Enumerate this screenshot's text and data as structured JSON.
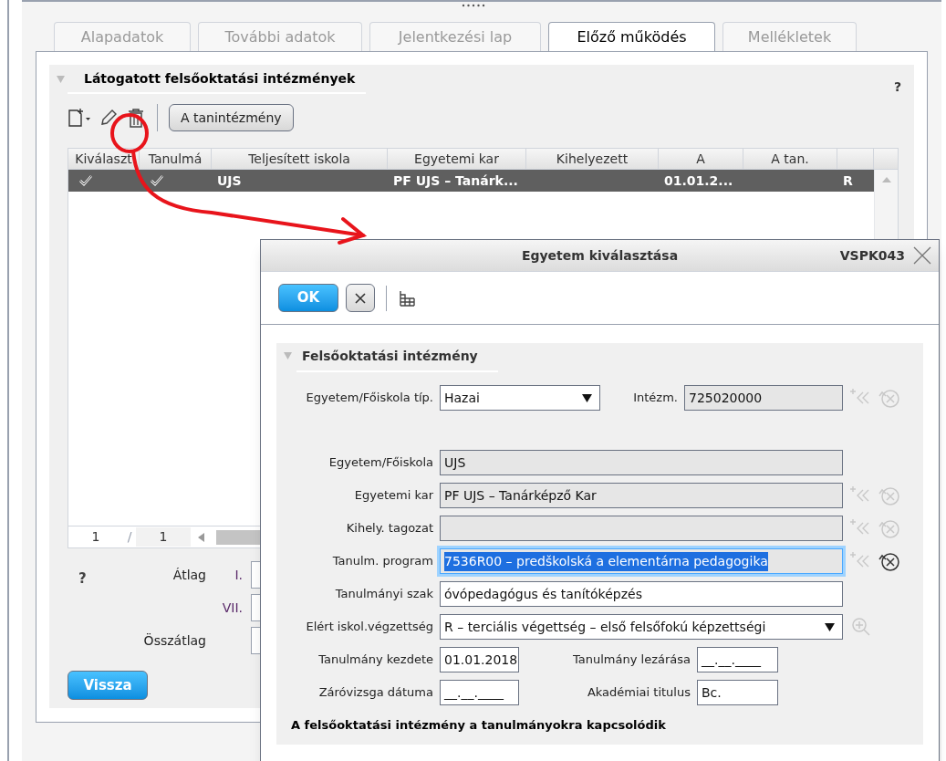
{
  "tabs": [
    {
      "label": "Alapadatok",
      "selected": false
    },
    {
      "label": "További adatok",
      "selected": false
    },
    {
      "label": "Jelentkezési lap",
      "selected": false
    },
    {
      "label": "Előző működés",
      "selected": true
    },
    {
      "label": "Mellékletek",
      "selected": false
    }
  ],
  "section": {
    "title": "Látogatott felsőoktatási intézmények",
    "help": "?"
  },
  "toolbar": {
    "button": "A tanintézmény"
  },
  "table": {
    "columns": [
      "Kiválaszt",
      "Tanulmá",
      "Teljesített iskola",
      "Egyetemi kar",
      "Kihelyezett",
      "A",
      "A tan."
    ],
    "rows": [
      {
        "selected": true,
        "cells": [
          {
            "kind": "check",
            "checked": true
          },
          {
            "kind": "check",
            "checked": true
          },
          {
            "kind": "text",
            "text": "UJS"
          },
          {
            "kind": "text",
            "text": "PF UJS – Tanárk..."
          },
          {
            "kind": "empty"
          },
          {
            "kind": "text",
            "text": "01.01.2..."
          },
          {
            "kind": "empty"
          },
          {
            "kind": "text",
            "text": "R"
          }
        ]
      }
    ],
    "pager": {
      "current": "1",
      "separator": "/",
      "total": "1"
    }
  },
  "averages": {
    "help": "?",
    "rows": [
      {
        "label": "Átlag",
        "term": "I."
      },
      {
        "term": "VII."
      },
      {
        "label": "Összátlag"
      }
    ]
  },
  "back_button": "Vissza",
  "dialog": {
    "title": "Egyetem kiválasztása",
    "code": "VSPK043",
    "ok": "OK",
    "section_title": "Felsőoktatási intézmény",
    "rows": [
      {
        "fields": [
          {
            "label": "Egyetem/Főiskola típ.",
            "kind": "select",
            "value": "Hazai",
            "readonly": false
          },
          {
            "label": "Intézm.",
            "kind": "text",
            "value": "725020000",
            "readonly": true,
            "buttons": [
              {
                "kind": "add",
                "disabled": true
              },
              {
                "kind": "clear",
                "disabled": true
              }
            ]
          }
        ]
      },
      {
        "fields": [
          {
            "label": "Egyetem/Főiskola",
            "kind": "text",
            "value": "UJS",
            "readonly": true
          }
        ]
      },
      {
        "fields": [
          {
            "label": "Egyetemi kar",
            "kind": "text",
            "value": "PF UJS – Tanárképző Kar",
            "readonly": true,
            "buttons": [
              {
                "kind": "add",
                "disabled": true
              },
              {
                "kind": "clear",
                "disabled": true
              }
            ]
          }
        ]
      },
      {
        "fields": [
          {
            "label": "Kihely. tagozat",
            "kind": "text",
            "readonly": true,
            "buttons": [
              {
                "kind": "add",
                "disabled": true
              },
              {
                "kind": "clear",
                "disabled": true
              }
            ]
          }
        ]
      },
      {
        "fields": [
          {
            "label": "Tanulm. program",
            "kind": "text",
            "value": "7536R00 – predškolská a elementárna pedagogika",
            "readonly": true,
            "focused": true,
            "buttons": [
              {
                "kind": "add",
                "disabled": true
              },
              {
                "kind": "clear",
                "disabled": false
              }
            ]
          }
        ]
      },
      {
        "fields": [
          {
            "label": "Tanulmányi szak",
            "kind": "text",
            "value": "óvópedagógus és tanítóképzés",
            "readonly": false
          }
        ]
      },
      {
        "fields": [
          {
            "label": "Elért iskol.végzettség",
            "kind": "select",
            "value": "R – terciális végettség – első felsőfokú képzettségi",
            "readonly": false,
            "buttons": [
              {
                "kind": "zoom",
                "disabled": true
              }
            ]
          }
        ]
      },
      {
        "fields": [
          {
            "label": "Tanulmány kezdete",
            "kind": "text",
            "value": "01.01.2018",
            "readonly": false
          },
          {
            "label": "Tanulmány lezárása",
            "kind": "text",
            "value": "__.__.____",
            "readonly": false
          }
        ]
      },
      {
        "fields": [
          {
            "label": "Záróvizsga dátuma",
            "kind": "text",
            "value": "__.__.____",
            "readonly": false
          },
          {
            "label": "Akadémiai titulus",
            "kind": "text",
            "value": "Bc.",
            "readonly": false
          }
        ]
      }
    ],
    "note": "A felsőoktatási intézmény a tanulmányokra kapcsolódik"
  }
}
